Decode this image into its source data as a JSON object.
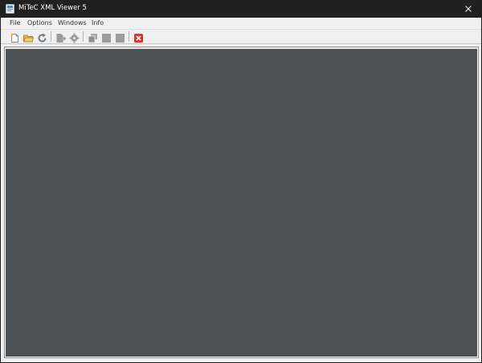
{
  "window": {
    "title": "MiTeC XML Viewer 5"
  },
  "menu": {
    "items": [
      {
        "label": "File"
      },
      {
        "label": "Options"
      },
      {
        "label": "Windows"
      },
      {
        "label": "Info"
      }
    ]
  },
  "toolbar": {
    "buttons": [
      {
        "icon": "new-document-icon",
        "enabled": true
      },
      {
        "icon": "open-folder-icon",
        "enabled": true
      },
      {
        "icon": "refresh-icon",
        "enabled": true
      },
      {
        "icon": "export-icon",
        "enabled": false
      },
      {
        "icon": "settings-icon",
        "enabled": false
      },
      {
        "icon": "cascade-windows-icon",
        "enabled": false
      },
      {
        "icon": "tile-horizontal-icon",
        "enabled": false
      },
      {
        "icon": "tile-vertical-icon",
        "enabled": false
      },
      {
        "icon": "close-all-icon",
        "enabled": true
      }
    ]
  },
  "colors": {
    "titlebar": "#202020",
    "workspace": "#4e5154",
    "chrome": "#f0f0f0",
    "close_accent": "#d7362b"
  }
}
